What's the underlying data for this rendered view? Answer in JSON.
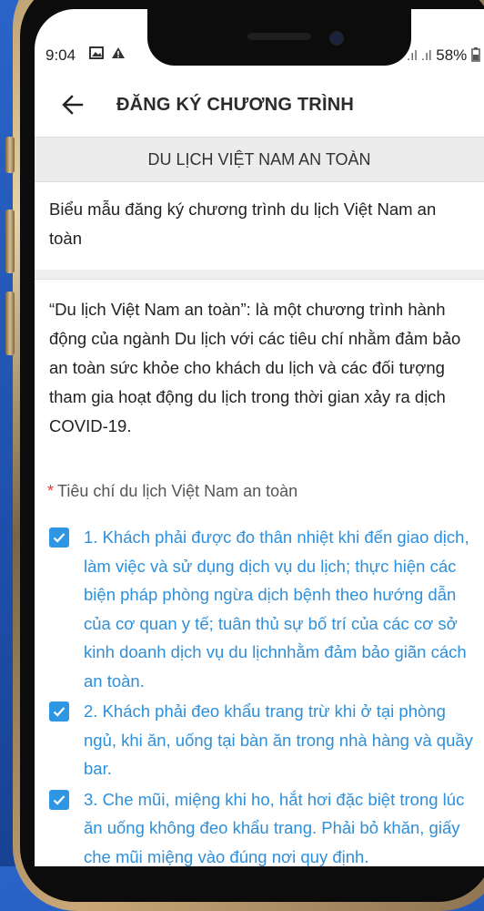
{
  "status_bar": {
    "time": "9:04",
    "left_icons": [
      "image-icon",
      "warning-icon"
    ],
    "signal_text": ".ıl .ıl",
    "battery": "58%"
  },
  "header": {
    "back_icon": "arrow-left-icon",
    "title": "ĐĂNG KÝ CHƯƠNG TRÌNH"
  },
  "program": {
    "name": "DU LỊCH VIỆT NAM AN TOÀN"
  },
  "form": {
    "title": "Biểu mẫu đăng ký chương trình du lịch Việt Nam an toàn",
    "description": "“Du lịch Việt Nam an toàn”: là một chương trình hành động của ngành Du lịch với các tiêu chí nhằm đảm bảo an toàn sức khỏe cho khách du lịch và các đối tượng tham gia hoạt động du lịch trong thời gian xảy ra dịch COVID-19.",
    "criteria_label": "Tiêu chí du lịch Việt Nam an toàn",
    "required_mark": "*",
    "criteria": [
      {
        "text": "1. Khách phải được đo thân nhiệt khi đến giao dịch, làm việc và sử dụng dịch vụ du lịch; thực hiện các biện pháp phòng ngừa dịch bệnh theo hướng dẫn của cơ quan y tế; tuân thủ sự bố trí của các cơ sở kinh doanh dịch vụ du lịchnhằm đảm bảo giãn cách an toàn.",
        "checked": true
      },
      {
        "text": "2. Khách phải đeo khẩu trang trừ khi ở tại phòng ngủ, khi ăn, uống tại bàn ăn trong nhà hàng và quầy bar.",
        "checked": true
      },
      {
        "text": "3. Che mũi, miệng khi ho, hắt hơi đặc biệt trong lúc ăn uống không đeo khẩu trang. Phải bỏ khăn, giấy che mũi miệng vào đúng nơi quy định.",
        "checked": true
      }
    ]
  },
  "colors": {
    "accent": "#2f96e4",
    "criteria_text": "#2f8fd8",
    "required": "#e53935"
  }
}
